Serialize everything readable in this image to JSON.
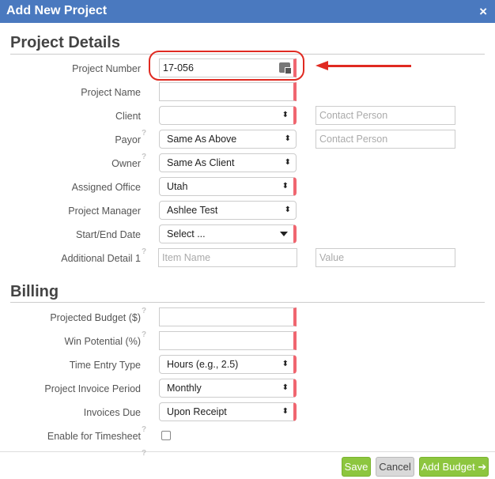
{
  "dialog": {
    "title": "Add New Project"
  },
  "sections": {
    "details": "Project Details",
    "billing": "Billing"
  },
  "fields": {
    "project_number": {
      "label": "Project Number",
      "value": "17-056"
    },
    "project_name": {
      "label": "Project Name",
      "value": ""
    },
    "client": {
      "label": "Client",
      "value": "",
      "contact_placeholder": "Contact Person"
    },
    "payor": {
      "label": "Payor",
      "value": "Same As Above",
      "contact_placeholder": "Contact Person"
    },
    "owner": {
      "label": "Owner",
      "value": "Same As Client"
    },
    "assigned_office": {
      "label": "Assigned Office",
      "value": "Utah"
    },
    "project_manager": {
      "label": "Project Manager",
      "value": "Ashlee Test"
    },
    "start_end_date": {
      "label": "Start/End Date",
      "value": "Select ..."
    },
    "additional_detail": {
      "label": "Additional Detail 1",
      "item_placeholder": "Item Name",
      "value_placeholder": "Value"
    },
    "projected_budget": {
      "label": "Projected Budget ($)",
      "value": ""
    },
    "win_potential": {
      "label": "Win Potential (%)",
      "value": ""
    },
    "time_entry_type": {
      "label": "Time Entry Type",
      "value": "Hours (e.g., 2.5)"
    },
    "invoice_period": {
      "label": "Project Invoice Period",
      "value": "Monthly"
    },
    "invoices_due": {
      "label": "Invoices Due",
      "value": "Upon Receipt"
    },
    "enable_timesheet": {
      "label": "Enable for Timesheet",
      "checked": false
    }
  },
  "icons": {
    "close": "×",
    "help": "?",
    "select_arrows": "⬍",
    "next_arrow": "➔"
  },
  "footer": {
    "save": "Save",
    "cancel": "Cancel",
    "add_budget": "Add Budget"
  },
  "colors": {
    "title_bar": "#4a79bf",
    "required": "#f06670",
    "primary_button": "#8dc63f",
    "annotation": "#e02a21"
  }
}
